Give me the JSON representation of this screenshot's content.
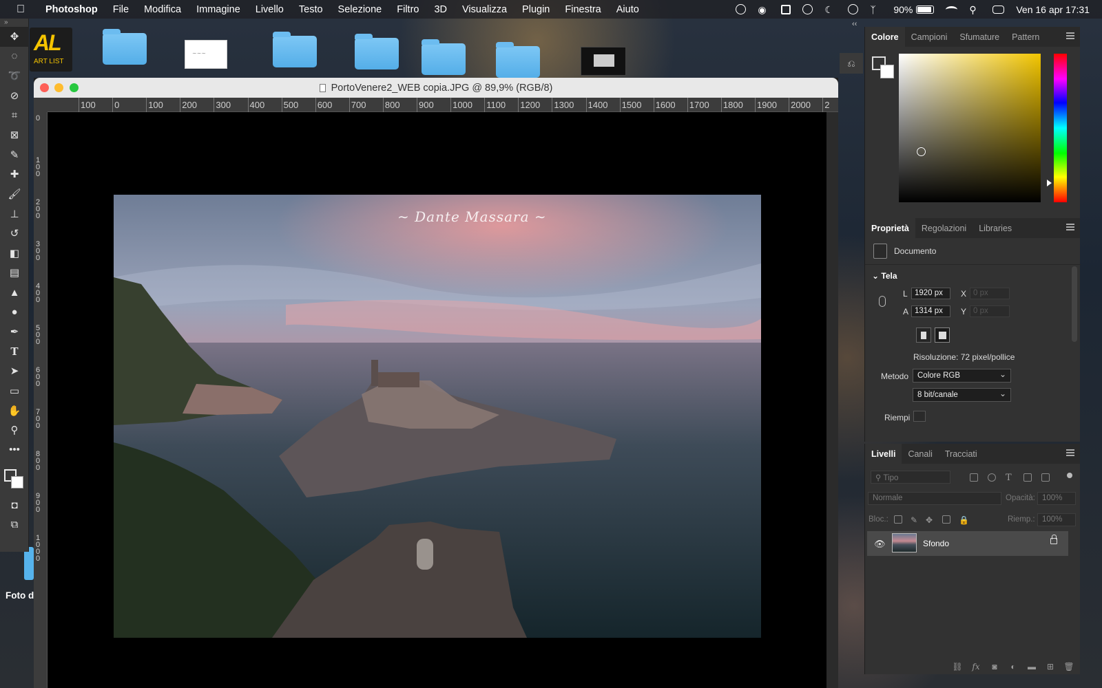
{
  "menubar": {
    "app_name": "Photoshop",
    "items": [
      "File",
      "Modifica",
      "Immagine",
      "Livello",
      "Testo",
      "Selezione",
      "Filtro",
      "3D",
      "Visualizza",
      "Plugin",
      "Finestra",
      "Aiuto"
    ],
    "battery_percent": "90%",
    "battery_level": 0.9,
    "datetime": "Ven 16 apr  17:31"
  },
  "desktop": {
    "logo_text": "AL",
    "logo_sub": "ART LIST",
    "foto_label": "Foto d"
  },
  "document": {
    "title": "PortoVenere2_WEB copia.JPG @ 89,9% (RGB/8)",
    "ruler_h": [
      "100",
      "0",
      "100",
      "200",
      "300",
      "400",
      "500",
      "600",
      "700",
      "800",
      "900",
      "1000",
      "1100",
      "1200",
      "1300",
      "1400",
      "1500",
      "1600",
      "1700",
      "1800",
      "1900",
      "2000",
      "2"
    ],
    "ruler_v": [
      "0",
      "1\n0\n0",
      "2\n0\n0",
      "3\n0\n0",
      "4\n0\n0",
      "5\n0\n0",
      "6\n0\n0",
      "7\n0\n0",
      "8\n0\n0",
      "9\n0\n0",
      "1\n0\n0\n0"
    ]
  },
  "color_panel": {
    "tabs": [
      "Colore",
      "Campioni",
      "Sfumature",
      "Pattern"
    ],
    "active_tab": "Colore",
    "hue_color": "#f2c500"
  },
  "properties_panel": {
    "tabs": [
      "Proprietà",
      "Regolazioni",
      "Libraries"
    ],
    "object_type": "Documento",
    "section": "Tela",
    "width_label": "L",
    "width_value": "1920 px",
    "height_label": "A",
    "height_value": "1314 px",
    "x_label": "X",
    "x_value": "0 px",
    "y_label": "Y",
    "y_value": "0 px",
    "resolution": "Risoluzione: 72 pixel/pollice",
    "mode_label": "Metodo",
    "mode_value": "Colore RGB",
    "depth_value": "8 bit/canale",
    "fill_label": "Riempi"
  },
  "layers_panel": {
    "tabs": [
      "Livelli",
      "Canali",
      "Tracciati"
    ],
    "filter_placeholder": "Tipo",
    "blend_mode": "Normale",
    "opacity_label": "Opacità:",
    "opacity_value": "100%",
    "lock_label": "Bloc.:",
    "fill_label": "Riemp.:",
    "fill_value": "100%",
    "layers": [
      {
        "name": "Sfondo",
        "visible": true,
        "locked": true
      }
    ]
  }
}
